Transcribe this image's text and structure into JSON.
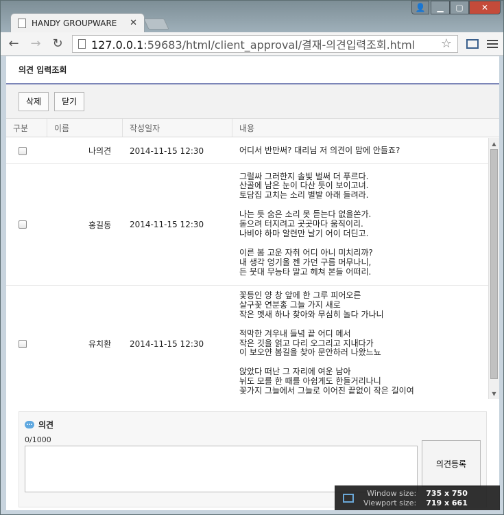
{
  "browser": {
    "tab_title": "HANDY GROUPWARE",
    "url_host": "127.0.0.1",
    "url_rest": ":59683/html/client_approval/결재-의견입력조회.html"
  },
  "page": {
    "title": "의견 입력조회",
    "buttons": {
      "delete": "삭제",
      "close": "닫기"
    },
    "columns": {
      "type": "구분",
      "name": "이름",
      "date": "작성일자",
      "content": "내용"
    },
    "rows": [
      {
        "name": "나의견",
        "date": "2014-11-15 12:30",
        "content": "어디서 반만써? 대리님 저 의견이 맘에 안들죠?"
      },
      {
        "name": "홍길동",
        "date": "2014-11-15 12:30",
        "content": "그럴싸 그러한지 솔빛 벌써 더 푸르다.\n산골에 남은 눈이 다산 듯이 보이고녀.\n토담집 고치는 소리 별발 아래 들려라.\n\n나는 듯 숨은 소리 못 듣는다 없을쏜가.\n돋으려 터지려고 곳곳마다 움직이리.\n나비야 하마 알련만 날기 어이 더딘고.\n\n이른 봄 고운 자취 어디 아니 미치리까?\n내 생각 엉기올 젠 가던 구름 머무나니,\n든 붓대 무능타 말고 헤쳐 본들 어떠리."
      },
      {
        "name": "유치환",
        "date": "2014-11-15 12:30",
        "content": "꽃등인 양 창 앞에 한 그루 피어오른\n살구꽃 연분홍 그늘 가지 새로\n작은 멧새 하나 찾아와 무심히 놀다 가나니\n\n적막한 겨우내 들녘 끝 어디 메서\n작은 깃을 얽고 다리 오그리고 지내다가\n이 보오얀 봄길을 찾아 문안하러 나왔느뇨\n\n앉았다 떠난 그 자리에 여운 남아\n뉘도 모를 한 때를 아쉽게도 한들거리나니\n꽃가지 그늘에서 그늘로 이어진 끝없이 작은 길이여"
      }
    ],
    "opinion": {
      "label": "의견",
      "counter": "0/1000",
      "submit": "의견등록"
    }
  },
  "overlay": {
    "window_label": "Window size:",
    "window_value": "735 x 750",
    "viewport_label": "Viewport size:",
    "viewport_value": "719 x 661"
  }
}
